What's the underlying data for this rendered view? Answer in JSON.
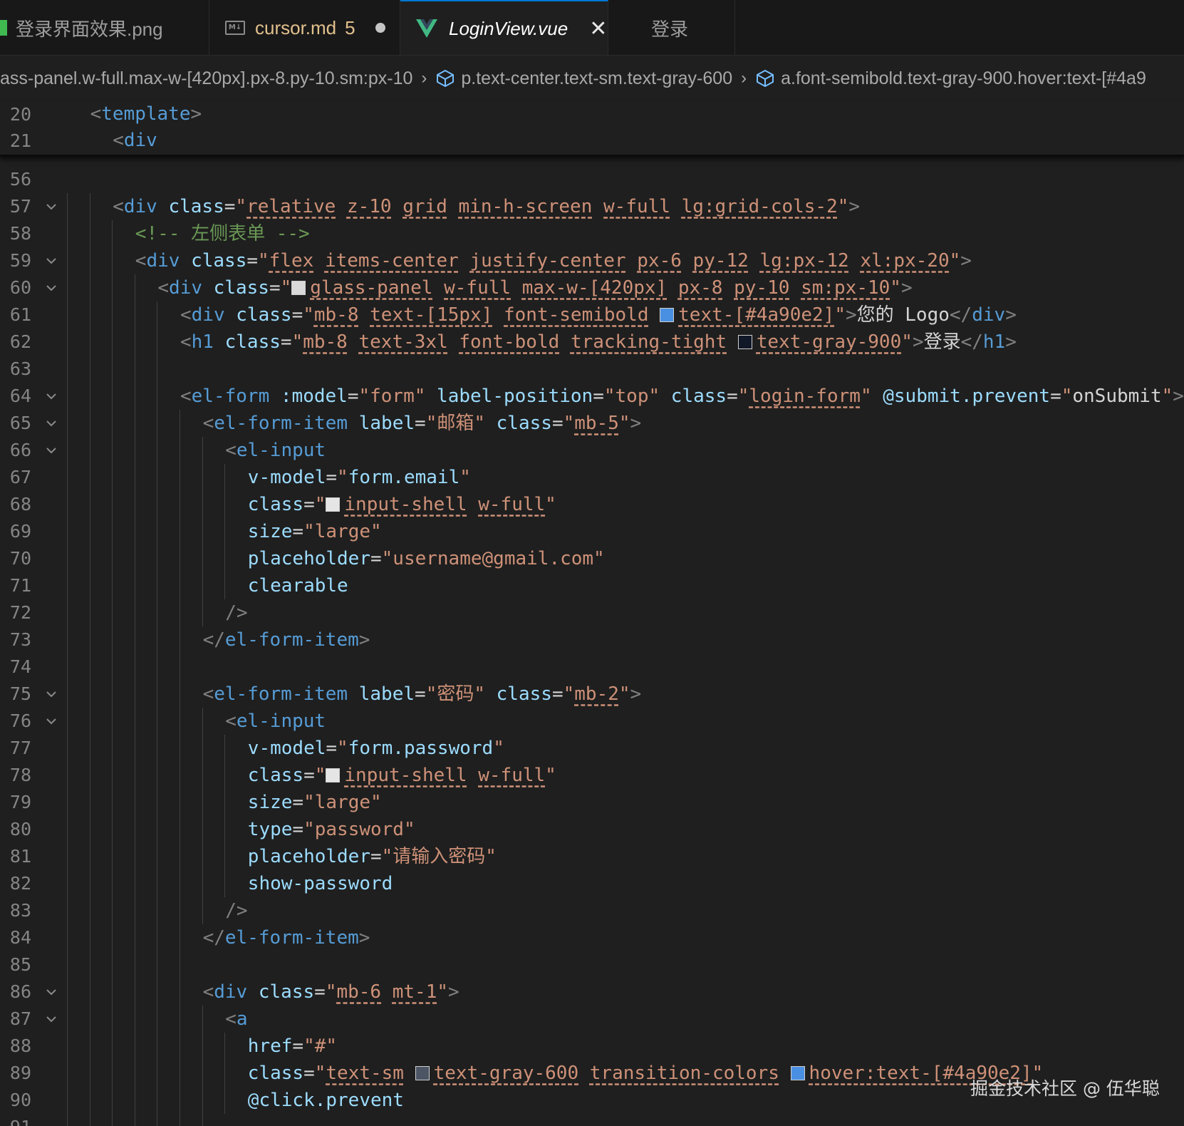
{
  "tabs": [
    {
      "label": "登录界面效果.png",
      "icon": "image-file-icon"
    },
    {
      "label": "cursor.md",
      "icon": "markdown-file-icon",
      "problems": "5"
    },
    {
      "label": "LoginView.vue",
      "icon": "vue-file-icon",
      "active": true
    },
    {
      "label": "登录"
    }
  ],
  "breadcrumb": [
    "ass-panel.w-full.max-w-[420px].px-8.py-10.sm:px-10",
    "p.text-center.text-sm.text-gray-600",
    "a.font-semibold.text-gray-900.hover:text-[#4a9"
  ],
  "sticky": [
    {
      "n": "20",
      "indent": 1,
      "parts": [
        [
          "p",
          "<"
        ],
        [
          "t",
          "template"
        ],
        [
          "p",
          ">"
        ]
      ]
    },
    {
      "n": "21",
      "indent": 2,
      "parts": [
        [
          "p",
          "<"
        ],
        [
          "t",
          "div"
        ]
      ]
    }
  ],
  "code": [
    {
      "n": "56",
      "indent": 0,
      "fold": false,
      "parts": []
    },
    {
      "n": "57",
      "indent": 2,
      "fold": true,
      "parts": [
        [
          "p",
          "<"
        ],
        [
          "t",
          "div"
        ],
        [
          "x",
          " "
        ],
        [
          "a",
          "class"
        ],
        [
          "x",
          "="
        ],
        [
          "s",
          "\""
        ],
        [
          "su",
          "relative"
        ],
        [
          "x",
          " "
        ],
        [
          "su",
          "z-10"
        ],
        [
          "x",
          " "
        ],
        [
          "su",
          "grid"
        ],
        [
          "x",
          " "
        ],
        [
          "su",
          "min-h-screen"
        ],
        [
          "x",
          " "
        ],
        [
          "su",
          "w-full"
        ],
        [
          "x",
          " "
        ],
        [
          "su",
          "lg:grid-cols-2"
        ],
        [
          "s",
          "\""
        ],
        [
          "p",
          ">"
        ]
      ]
    },
    {
      "n": "58",
      "indent": 3,
      "fold": false,
      "parts": [
        [
          "c",
          "<!-- 左侧表单 -->"
        ]
      ]
    },
    {
      "n": "59",
      "indent": 3,
      "fold": true,
      "parts": [
        [
          "p",
          "<"
        ],
        [
          "t",
          "div"
        ],
        [
          "x",
          " "
        ],
        [
          "a",
          "class"
        ],
        [
          "x",
          "="
        ],
        [
          "s",
          "\""
        ],
        [
          "su",
          "flex"
        ],
        [
          "x",
          " "
        ],
        [
          "su",
          "items-center"
        ],
        [
          "x",
          " "
        ],
        [
          "su",
          "justify-center"
        ],
        [
          "x",
          " "
        ],
        [
          "su",
          "px-6"
        ],
        [
          "x",
          " "
        ],
        [
          "su",
          "py-12"
        ],
        [
          "x",
          " "
        ],
        [
          "su",
          "lg:px-12"
        ],
        [
          "x",
          " "
        ],
        [
          "su",
          "xl:px-20"
        ],
        [
          "s",
          "\""
        ],
        [
          "p",
          ">"
        ]
      ]
    },
    {
      "n": "60",
      "indent": 4,
      "fold": true,
      "parts": [
        [
          "p",
          "<"
        ],
        [
          "t",
          "div"
        ],
        [
          "x",
          " "
        ],
        [
          "a",
          "class"
        ],
        [
          "x",
          "="
        ],
        [
          "s",
          "\""
        ],
        [
          "sw",
          "#d9d9d9"
        ],
        [
          "su",
          "glass-panel"
        ],
        [
          "x",
          " "
        ],
        [
          "su",
          "w-full"
        ],
        [
          "x",
          " "
        ],
        [
          "su",
          "max-w-[420px]"
        ],
        [
          "x",
          " "
        ],
        [
          "su",
          "px-8"
        ],
        [
          "x",
          " "
        ],
        [
          "su",
          "py-10"
        ],
        [
          "x",
          " "
        ],
        [
          "su",
          "sm:px-10"
        ],
        [
          "s",
          "\""
        ],
        [
          "p",
          ">"
        ]
      ]
    },
    {
      "n": "61",
      "indent": 5,
      "fold": false,
      "parts": [
        [
          "p",
          "<"
        ],
        [
          "t",
          "div"
        ],
        [
          "x",
          " "
        ],
        [
          "a",
          "class"
        ],
        [
          "x",
          "="
        ],
        [
          "s",
          "\""
        ],
        [
          "su",
          "mb-8"
        ],
        [
          "x",
          " "
        ],
        [
          "su",
          "text-[15px]"
        ],
        [
          "x",
          " "
        ],
        [
          "su",
          "font-semibold"
        ],
        [
          "x",
          " "
        ],
        [
          "sw",
          "#4a90e2"
        ],
        [
          "su",
          "text-[#4a90e2]"
        ],
        [
          "s",
          "\""
        ],
        [
          "p",
          ">"
        ],
        [
          "x",
          "您的 Logo"
        ],
        [
          "p",
          "</"
        ],
        [
          "t",
          "div"
        ],
        [
          "p",
          ">"
        ]
      ]
    },
    {
      "n": "62",
      "indent": 5,
      "fold": false,
      "parts": [
        [
          "p",
          "<"
        ],
        [
          "t",
          "h1"
        ],
        [
          "x",
          " "
        ],
        [
          "a",
          "class"
        ],
        [
          "x",
          "="
        ],
        [
          "s",
          "\""
        ],
        [
          "su",
          "mb-8"
        ],
        [
          "x",
          " "
        ],
        [
          "su",
          "text-3xl"
        ],
        [
          "x",
          " "
        ],
        [
          "su",
          "font-bold"
        ],
        [
          "x",
          " "
        ],
        [
          "su",
          "tracking-tight"
        ],
        [
          "x",
          " "
        ],
        [
          "sw",
          "#111827"
        ],
        [
          "su",
          "text-gray-900"
        ],
        [
          "s",
          "\""
        ],
        [
          "p",
          ">"
        ],
        [
          "x",
          "登录"
        ],
        [
          "p",
          "</"
        ],
        [
          "t",
          "h1"
        ],
        [
          "p",
          ">"
        ]
      ]
    },
    {
      "n": "63",
      "indent": 5,
      "fold": false,
      "parts": []
    },
    {
      "n": "64",
      "indent": 5,
      "fold": true,
      "parts": [
        [
          "p",
          "<"
        ],
        [
          "t",
          "el-form"
        ],
        [
          "x",
          " "
        ],
        [
          "a",
          ":model"
        ],
        [
          "x",
          "="
        ],
        [
          "s",
          "\"form\""
        ],
        [
          "x",
          " "
        ],
        [
          "a",
          "label-position"
        ],
        [
          "x",
          "="
        ],
        [
          "s",
          "\"top\""
        ],
        [
          "x",
          " "
        ],
        [
          "a",
          "class"
        ],
        [
          "x",
          "="
        ],
        [
          "s",
          "\""
        ],
        [
          "su",
          "login-form"
        ],
        [
          "s",
          "\""
        ],
        [
          "x",
          " "
        ],
        [
          "a",
          "@submit.prevent"
        ],
        [
          "x",
          "="
        ],
        [
          "s",
          "\""
        ],
        [
          "x",
          "onSubmit"
        ],
        [
          "s",
          "\""
        ],
        [
          "p",
          ">"
        ]
      ]
    },
    {
      "n": "65",
      "indent": 6,
      "fold": true,
      "parts": [
        [
          "p",
          "<"
        ],
        [
          "t",
          "el-form-item"
        ],
        [
          "x",
          " "
        ],
        [
          "a",
          "label"
        ],
        [
          "x",
          "="
        ],
        [
          "s",
          "\"邮箱\""
        ],
        [
          "x",
          " "
        ],
        [
          "a",
          "class"
        ],
        [
          "x",
          "="
        ],
        [
          "s",
          "\""
        ],
        [
          "su",
          "mb-5"
        ],
        [
          "s",
          "\""
        ],
        [
          "p",
          ">"
        ]
      ]
    },
    {
      "n": "66",
      "indent": 7,
      "fold": true,
      "parts": [
        [
          "p",
          "<"
        ],
        [
          "t",
          "el-input"
        ]
      ]
    },
    {
      "n": "67",
      "indent": 8,
      "fold": false,
      "parts": [
        [
          "a",
          "v-model"
        ],
        [
          "x",
          "="
        ],
        [
          "s",
          "\""
        ],
        [
          "a",
          "form.email"
        ],
        [
          "s",
          "\""
        ]
      ]
    },
    {
      "n": "68",
      "indent": 8,
      "fold": false,
      "parts": [
        [
          "a",
          "class"
        ],
        [
          "x",
          "="
        ],
        [
          "s",
          "\""
        ],
        [
          "sw",
          "#e5e5e5"
        ],
        [
          "su",
          "input-shell"
        ],
        [
          "x",
          " "
        ],
        [
          "su",
          "w-full"
        ],
        [
          "s",
          "\""
        ]
      ]
    },
    {
      "n": "69",
      "indent": 8,
      "fold": false,
      "parts": [
        [
          "a",
          "size"
        ],
        [
          "x",
          "="
        ],
        [
          "s",
          "\"large\""
        ]
      ]
    },
    {
      "n": "70",
      "indent": 8,
      "fold": false,
      "parts": [
        [
          "a",
          "placeholder"
        ],
        [
          "x",
          "="
        ],
        [
          "s",
          "\"username@gmail.com\""
        ]
      ]
    },
    {
      "n": "71",
      "indent": 8,
      "fold": false,
      "parts": [
        [
          "a",
          "clearable"
        ]
      ]
    },
    {
      "n": "72",
      "indent": 7,
      "fold": false,
      "parts": [
        [
          "p",
          "/>"
        ]
      ]
    },
    {
      "n": "73",
      "indent": 6,
      "fold": false,
      "parts": [
        [
          "p",
          "</"
        ],
        [
          "t",
          "el-form-item"
        ],
        [
          "p",
          ">"
        ]
      ]
    },
    {
      "n": "74",
      "indent": 6,
      "fold": false,
      "parts": []
    },
    {
      "n": "75",
      "indent": 6,
      "fold": true,
      "parts": [
        [
          "p",
          "<"
        ],
        [
          "t",
          "el-form-item"
        ],
        [
          "x",
          " "
        ],
        [
          "a",
          "label"
        ],
        [
          "x",
          "="
        ],
        [
          "s",
          "\"密码\""
        ],
        [
          "x",
          " "
        ],
        [
          "a",
          "class"
        ],
        [
          "x",
          "="
        ],
        [
          "s",
          "\""
        ],
        [
          "su",
          "mb-2"
        ],
        [
          "s",
          "\""
        ],
        [
          "p",
          ">"
        ]
      ]
    },
    {
      "n": "76",
      "indent": 7,
      "fold": true,
      "parts": [
        [
          "p",
          "<"
        ],
        [
          "t",
          "el-input"
        ]
      ]
    },
    {
      "n": "77",
      "indent": 8,
      "fold": false,
      "parts": [
        [
          "a",
          "v-model"
        ],
        [
          "x",
          "="
        ],
        [
          "s",
          "\""
        ],
        [
          "a",
          "form.password"
        ],
        [
          "s",
          "\""
        ]
      ]
    },
    {
      "n": "78",
      "indent": 8,
      "fold": false,
      "parts": [
        [
          "a",
          "class"
        ],
        [
          "x",
          "="
        ],
        [
          "s",
          "\""
        ],
        [
          "sw",
          "#e5e5e5"
        ],
        [
          "su",
          "input-shell"
        ],
        [
          "x",
          " "
        ],
        [
          "su",
          "w-full"
        ],
        [
          "s",
          "\""
        ]
      ]
    },
    {
      "n": "79",
      "indent": 8,
      "fold": false,
      "parts": [
        [
          "a",
          "size"
        ],
        [
          "x",
          "="
        ],
        [
          "s",
          "\"large\""
        ]
      ]
    },
    {
      "n": "80",
      "indent": 8,
      "fold": false,
      "parts": [
        [
          "a",
          "type"
        ],
        [
          "x",
          "="
        ],
        [
          "s",
          "\"password\""
        ]
      ]
    },
    {
      "n": "81",
      "indent": 8,
      "fold": false,
      "parts": [
        [
          "a",
          "placeholder"
        ],
        [
          "x",
          "="
        ],
        [
          "s",
          "\"请输入密码\""
        ]
      ]
    },
    {
      "n": "82",
      "indent": 8,
      "fold": false,
      "parts": [
        [
          "a",
          "show-password"
        ]
      ]
    },
    {
      "n": "83",
      "indent": 7,
      "fold": false,
      "parts": [
        [
          "p",
          "/>"
        ]
      ]
    },
    {
      "n": "84",
      "indent": 6,
      "fold": false,
      "parts": [
        [
          "p",
          "</"
        ],
        [
          "t",
          "el-form-item"
        ],
        [
          "p",
          ">"
        ]
      ]
    },
    {
      "n": "85",
      "indent": 6,
      "fold": false,
      "parts": []
    },
    {
      "n": "86",
      "indent": 6,
      "fold": true,
      "parts": [
        [
          "p",
          "<"
        ],
        [
          "t",
          "div"
        ],
        [
          "x",
          " "
        ],
        [
          "a",
          "class"
        ],
        [
          "x",
          "="
        ],
        [
          "s",
          "\""
        ],
        [
          "su",
          "mb-6"
        ],
        [
          "x",
          " "
        ],
        [
          "su",
          "mt-1"
        ],
        [
          "s",
          "\""
        ],
        [
          "p",
          ">"
        ]
      ]
    },
    {
      "n": "87",
      "indent": 7,
      "fold": true,
      "parts": [
        [
          "p",
          "<"
        ],
        [
          "t",
          "a"
        ]
      ]
    },
    {
      "n": "88",
      "indent": 8,
      "fold": false,
      "parts": [
        [
          "a",
          "href"
        ],
        [
          "x",
          "="
        ],
        [
          "s",
          "\"#\""
        ]
      ]
    },
    {
      "n": "89",
      "indent": 8,
      "fold": false,
      "parts": [
        [
          "a",
          "class"
        ],
        [
          "x",
          "="
        ],
        [
          "s",
          "\""
        ],
        [
          "su",
          "text-sm"
        ],
        [
          "x",
          " "
        ],
        [
          "sw",
          "#4b5563"
        ],
        [
          "su",
          "text-gray-600"
        ],
        [
          "x",
          " "
        ],
        [
          "su",
          "transition-colors"
        ],
        [
          "x",
          " "
        ],
        [
          "sw",
          "#4a90e2"
        ],
        [
          "su",
          "hover:text-[#4a90e2]"
        ],
        [
          "s",
          "\""
        ]
      ]
    },
    {
      "n": "90",
      "indent": 8,
      "fold": false,
      "parts": [
        [
          "a",
          "@click.prevent"
        ]
      ]
    },
    {
      "n": "91",
      "indent": 7,
      "fold": false,
      "parts": []
    }
  ],
  "watermark": "掘金技术社区 @ 伍华聪"
}
